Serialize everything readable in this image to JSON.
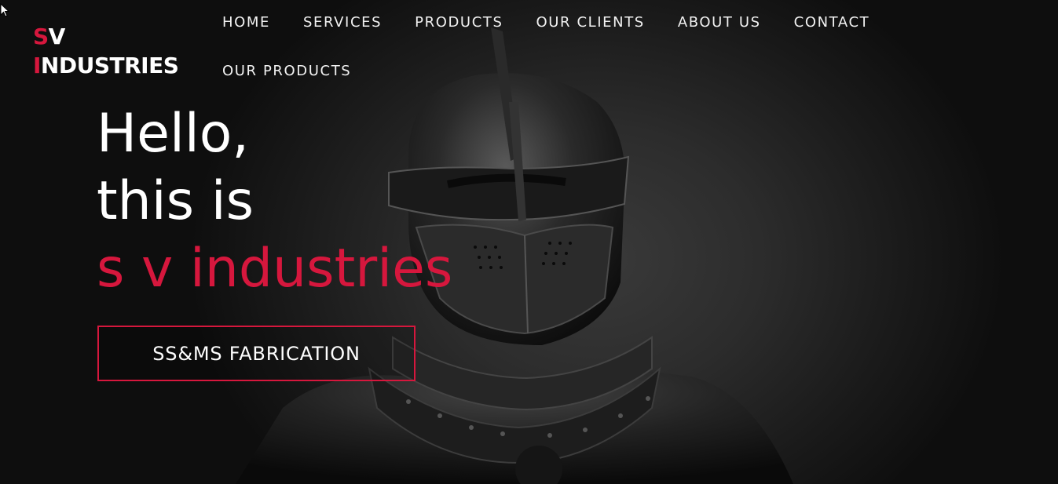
{
  "logo": {
    "line1_first": "S",
    "line1_rest": "V",
    "line2_first": "I",
    "line2_rest": "NDUSTRIES"
  },
  "nav": {
    "items": [
      {
        "label": "HOME"
      },
      {
        "label": "SERVICES"
      },
      {
        "label": "PRODUCTS"
      },
      {
        "label": "OUR CLIENTS"
      },
      {
        "label": "ABOUT US"
      },
      {
        "label": "CONTACT"
      },
      {
        "label": "OUR PRODUCTS"
      }
    ]
  },
  "hero": {
    "line1": "Hello,",
    "line2": "this is",
    "line3": "s v industries",
    "cta_label": "SS&MS FABRICATION"
  },
  "colors": {
    "accent": "#d6173d",
    "background": "#1c1c1c",
    "text": "#ffffff"
  }
}
